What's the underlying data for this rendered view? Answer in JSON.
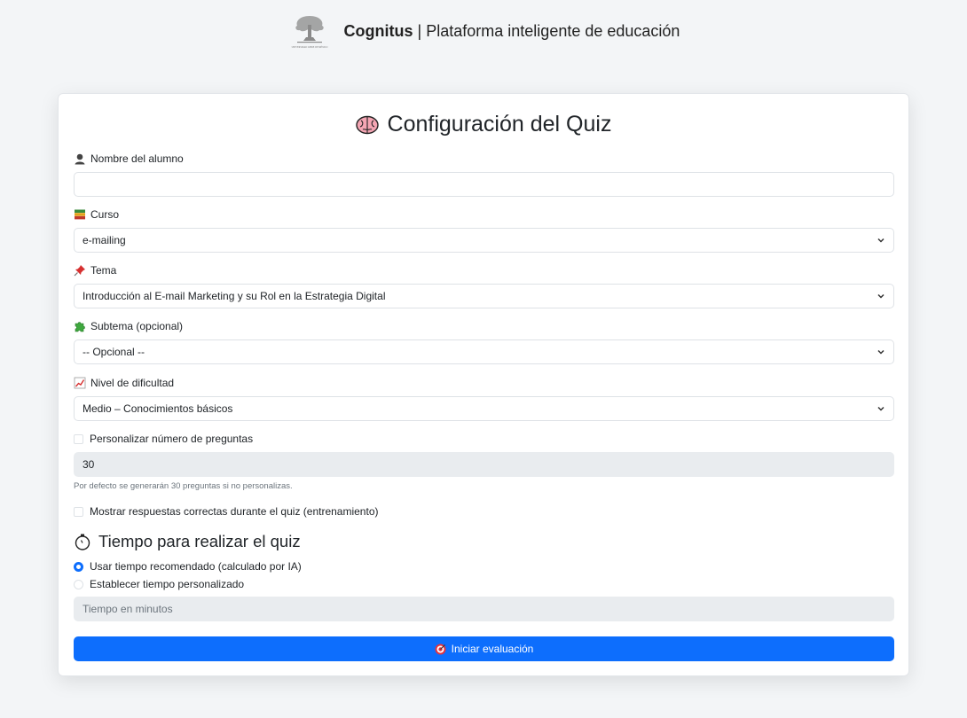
{
  "header": {
    "brand_name": "Cognitus",
    "separator": "|",
    "brand_tagline": "Plataforma inteligente de educación",
    "logo_caption": "UNIVERSIDAD LIBRE DE MÉXICO"
  },
  "form": {
    "title": "Configuración del Quiz",
    "student_name": {
      "label": "Nombre del alumno",
      "value": ""
    },
    "course": {
      "label": "Curso",
      "value": "e-mailing"
    },
    "topic": {
      "label": "Tema",
      "value": "Introducción al E-mail Marketing y su Rol en la Estrategia Digital"
    },
    "subtopic": {
      "label": "Subtema (opcional)",
      "value": "-- Opcional --"
    },
    "difficulty": {
      "label": "Nivel de dificultad",
      "value": "Medio – Conocimientos básicos"
    },
    "custom_questions": {
      "label": "Personalizar número de preguntas",
      "checked": false
    },
    "question_count": {
      "value": "30"
    },
    "question_help": "Por defecto se generarán 30 preguntas si no personalizas.",
    "show_answers": {
      "label": "Mostrar respuestas correctas durante el quiz (entrenamiento)",
      "checked": false
    },
    "time_section": {
      "title": "Tiempo para realizar el quiz",
      "recommended": {
        "label": "Usar tiempo recomendado (calculado por IA)",
        "selected": true
      },
      "custom": {
        "label": "Establecer tiempo personalizado",
        "selected": false
      },
      "minutes_placeholder": "Tiempo en minutos"
    },
    "submit_label": "Iniciar evaluación"
  },
  "colors": {
    "primary": "#0d6efd",
    "page_background": "#f3f5f7",
    "disabled_field": "#e9ecef"
  },
  "icons": {
    "title": "brain-icon",
    "student_name": "bust-silhouette-icon",
    "course": "books-icon",
    "topic": "pushpin-icon",
    "subtopic": "puzzle-piece-icon",
    "difficulty": "chart-increasing-icon",
    "time_section": "stopwatch-icon",
    "submit": "target-icon",
    "select_arrow": "chevron-down-icon"
  }
}
